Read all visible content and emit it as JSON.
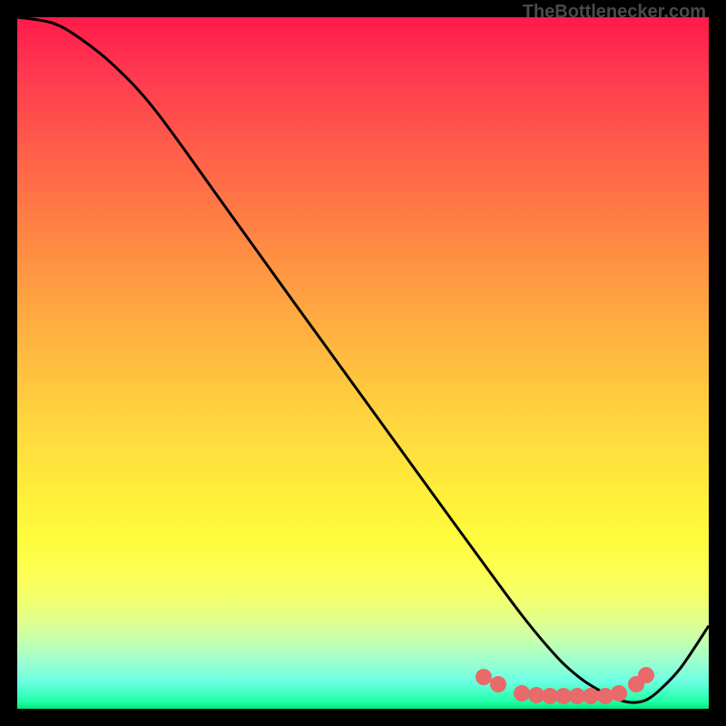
{
  "watermark": "TheBottlenecker.com",
  "chart_data": {
    "type": "line",
    "title": "",
    "xlabel": "",
    "ylabel": "",
    "xlim": [
      0,
      100
    ],
    "ylim": [
      0,
      100
    ],
    "series": [
      {
        "name": "curve",
        "x": [
          0,
          5,
          9,
          14,
          20,
          30,
          40,
          50,
          60,
          64,
          67,
          70,
          73,
          76,
          79,
          82,
          85,
          87,
          89,
          91,
          93,
          96,
          100
        ],
        "y": [
          100,
          99.2,
          97,
          93,
          86.5,
          72.7,
          58.8,
          45,
          31.2,
          25.7,
          21.6,
          17.5,
          13.5,
          9.8,
          6.5,
          4.0,
          2.2,
          1.3,
          0.9,
          1.3,
          2.8,
          6.0,
          12.0
        ]
      }
    ],
    "marker_points": {
      "x": [
        67.5,
        69.5,
        73,
        75,
        77,
        79,
        81,
        83,
        85,
        87,
        89.5,
        91
      ],
      "y": [
        4.6,
        3.5,
        2.2,
        2.0,
        1.9,
        1.9,
        1.9,
        1.9,
        1.9,
        2.2,
        3.5,
        4.8
      ]
    },
    "background": "gradient-red-yellow-green-vertical"
  }
}
